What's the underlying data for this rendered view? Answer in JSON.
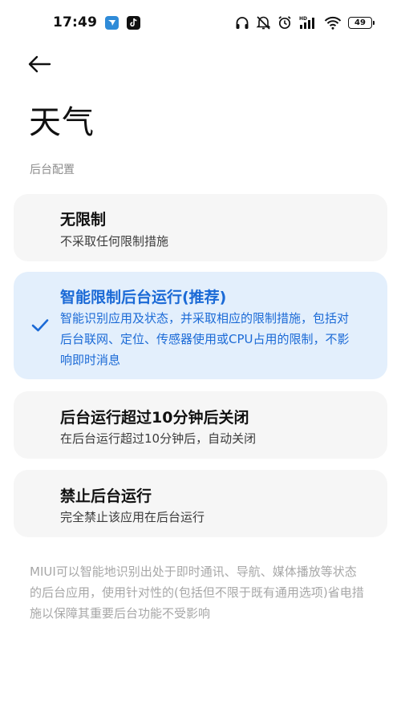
{
  "status_bar": {
    "time": "17:49",
    "battery_level": "49",
    "network_label": "HD",
    "icons": [
      "app-blue-badge-icon",
      "tiktok-icon",
      "headphones-icon",
      "mute-icon",
      "alarm-icon",
      "signal-icon",
      "wifi-icon",
      "battery-icon"
    ]
  },
  "header": {
    "back_icon": "arrow-left-icon",
    "title": "天气"
  },
  "section": {
    "label": "后台配置"
  },
  "options": [
    {
      "title": "无限制",
      "description": "不采取任何限制措施",
      "selected": false
    },
    {
      "title": "智能限制后台运行(推荐)",
      "description": "智能识别应用及状态，并采取相应的限制措施，包括对后台联网、定位、传感器使用或CPU占用的限制，不影响即时消息",
      "selected": true
    },
    {
      "title": "后台运行超过10分钟后关闭",
      "description": "在后台运行超过10分钟后，自动关闭",
      "selected": false
    },
    {
      "title": "禁止后台运行",
      "description": "完全禁止该应用在后台运行",
      "selected": false
    }
  ],
  "footer": {
    "note": "MIUI可以智能地识别出处于即时通讯、导航、媒体播放等状态的后台应用，使用针对性的(包括但不限于既有通用选项)省电措施以保障其重要后台功能不受影响"
  },
  "colors": {
    "accent": "#1b6ad6",
    "selected_card": "#e3effc",
    "card": "#f6f6f6",
    "muted_text": "#a7a7a7"
  }
}
